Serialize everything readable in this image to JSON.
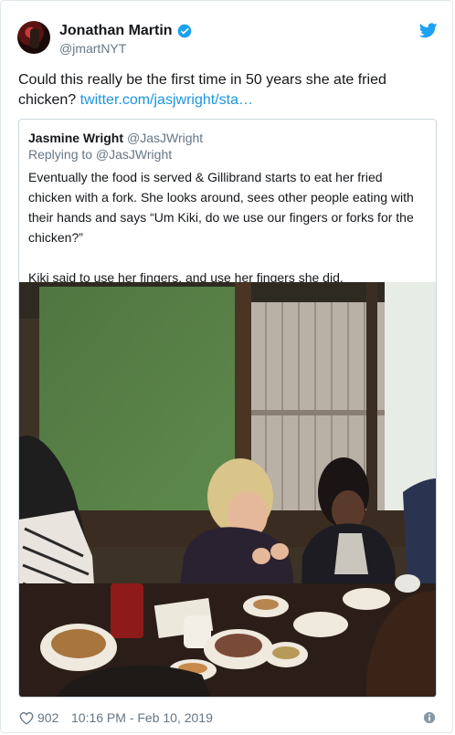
{
  "tweet": {
    "author_name": "Jonathan Martin",
    "author_handle": "@jmartNYT",
    "text_main": "Could this really be the first time in 50 years she ate fried chicken? ",
    "link": "twitter.com/jasjwright/sta…",
    "likes": "902",
    "timestamp": "10:16 PM - Feb 10, 2019"
  },
  "quote": {
    "author_name": "Jasmine Wright",
    "author_handle": "@JasJWright",
    "replying_to": "Replying to @JasJWright",
    "paragraph1": "Eventually the food is served & Gillibrand starts to eat her fried chicken with a fork. She looks around, sees other people eating with their hands and says “Um Kiki, do we use our fingers or forks for the chicken?”",
    "paragraph2": "Kiki said to use her fingers, and use her fingers she did."
  },
  "icons": {
    "verified": "verified-badge-icon",
    "bird": "twitter-bird-icon",
    "heart": "heart-icon",
    "info": "info-icon"
  },
  "colors": {
    "accent": "#1da1f2",
    "link": "#1b95e0",
    "muted": "#657786"
  }
}
